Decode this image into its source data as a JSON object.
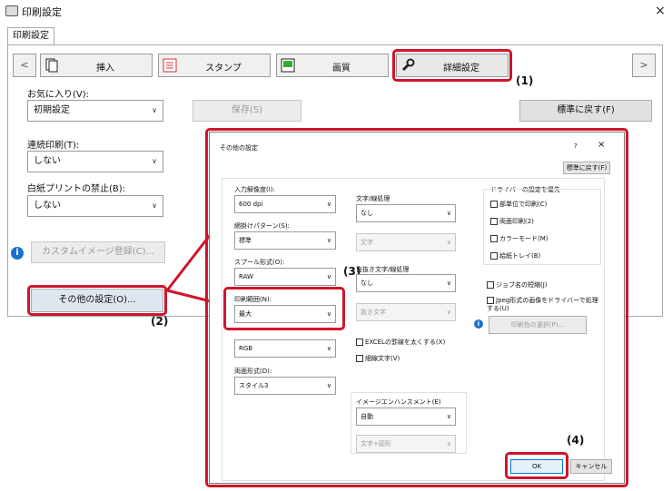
{
  "window": {
    "title": "印刷設定",
    "close": "×"
  },
  "tab": "印刷設定",
  "toolbar": {
    "prev": "<",
    "next": ">",
    "buttons": [
      {
        "label": "挿入",
        "icon": "insert-pages-icon"
      },
      {
        "label": "スタンプ",
        "icon": "stamp-icon"
      },
      {
        "label": "画質",
        "icon": "image-quality-icon"
      },
      {
        "label": "詳細設定",
        "icon": "wrench-icon"
      }
    ]
  },
  "favorites": {
    "label": "お気に入り(V):",
    "value": "初期設定",
    "save": "保存(S)",
    "reset": "標準に戻す(F)"
  },
  "continuous": {
    "label": "連続印刷(T):",
    "value": "しない"
  },
  "blank": {
    "label": "白紙プリントの禁止(B):",
    "value": "しない"
  },
  "custom_image": "カスタムイメージ登録(C)...",
  "info_symbol": "i",
  "other_settings": "その他の設定(O)...",
  "callouts": [
    "(1)",
    "(2)",
    "(3)",
    "(4)"
  ],
  "dialog": {
    "title": "その他の設定",
    "help": "?",
    "close": "×",
    "reset": "標準に戻す(F)",
    "resolution": {
      "label": "入力解像度(I):",
      "value": "600 dpi"
    },
    "pattern": {
      "label": "網掛けパターン(S):",
      "value": "標準"
    },
    "spool": {
      "label": "スプール形式(O):",
      "value": "RAW"
    },
    "print_mode": {
      "label": "印刷範囲(N):",
      "value": "最大"
    },
    "color_label": "RGB",
    "pattern_fmt": {
      "label": "両面形式(D):",
      "value": "スタイル3"
    },
    "text_line": {
      "label": "文字/線処理",
      "value": "なし",
      "sub": "文字"
    },
    "outline": {
      "label": "白抜き文字/線処理",
      "value": "なし",
      "sub": "抜き文字"
    },
    "excel_thick": "EXCELの罫線を太くする(X)",
    "thin_text": "細線文字(V)",
    "enhance": {
      "label": "イメージエンハンスメント(E)",
      "value": "自動",
      "sub": "文字+図形"
    },
    "driver_priority": {
      "label": "ドライバーの設定を優先",
      "items": [
        "部単位で印刷(C)",
        "両面印刷(2)",
        "カラーモード(M)",
        "給紙トレイ(B)"
      ]
    },
    "job_shorten": "ジョブ名の短縮(J)",
    "jpeg": "Jpeg形式の画像をドライバーで処理する(U)",
    "color_select": "印刷色の選択(P)...",
    "ok": "OK",
    "cancel": "キャンセル"
  }
}
